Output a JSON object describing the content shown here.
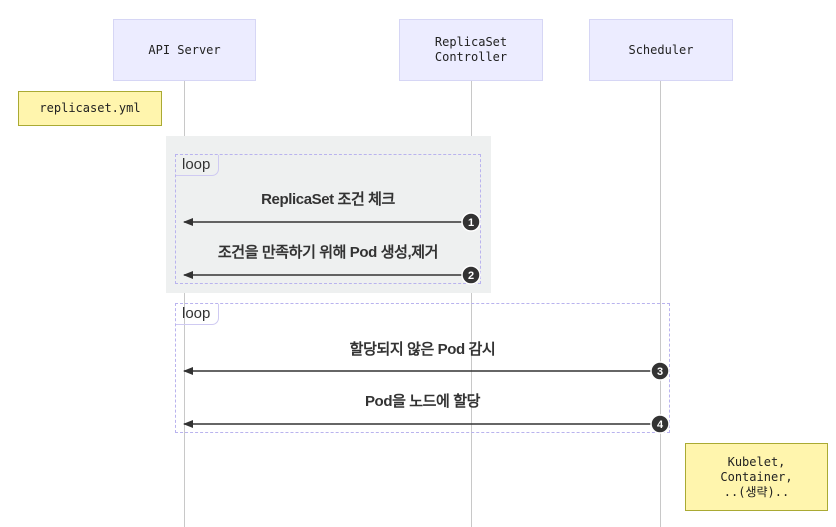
{
  "participants": {
    "api_server": "API Server",
    "replicaset_controller": "ReplicaSet\nController",
    "scheduler": "Scheduler"
  },
  "notes": {
    "replicaset_yml": "replicaset.yml",
    "kubelet_line1": "Kubelet,",
    "kubelet_line2": "Container,",
    "kubelet_line3": "..(생략).."
  },
  "loops": [
    {
      "label": "loop"
    },
    {
      "label": "loop"
    }
  ],
  "messages": [
    {
      "number": "1",
      "text": "ReplicaSet 조건 체크"
    },
    {
      "number": "2",
      "text": "조건을 만족하기 위해 Pod 생성,제거"
    },
    {
      "number": "3",
      "text": "할당되지 않은 Pod 감시"
    },
    {
      "number": "4",
      "text": "Pod을 노드에 할당"
    }
  ],
  "colors": {
    "actor_fill": "#ececff",
    "note_fill": "#fff5ad",
    "loop_highlight": "#eef0f0",
    "arrow": "#333333"
  }
}
